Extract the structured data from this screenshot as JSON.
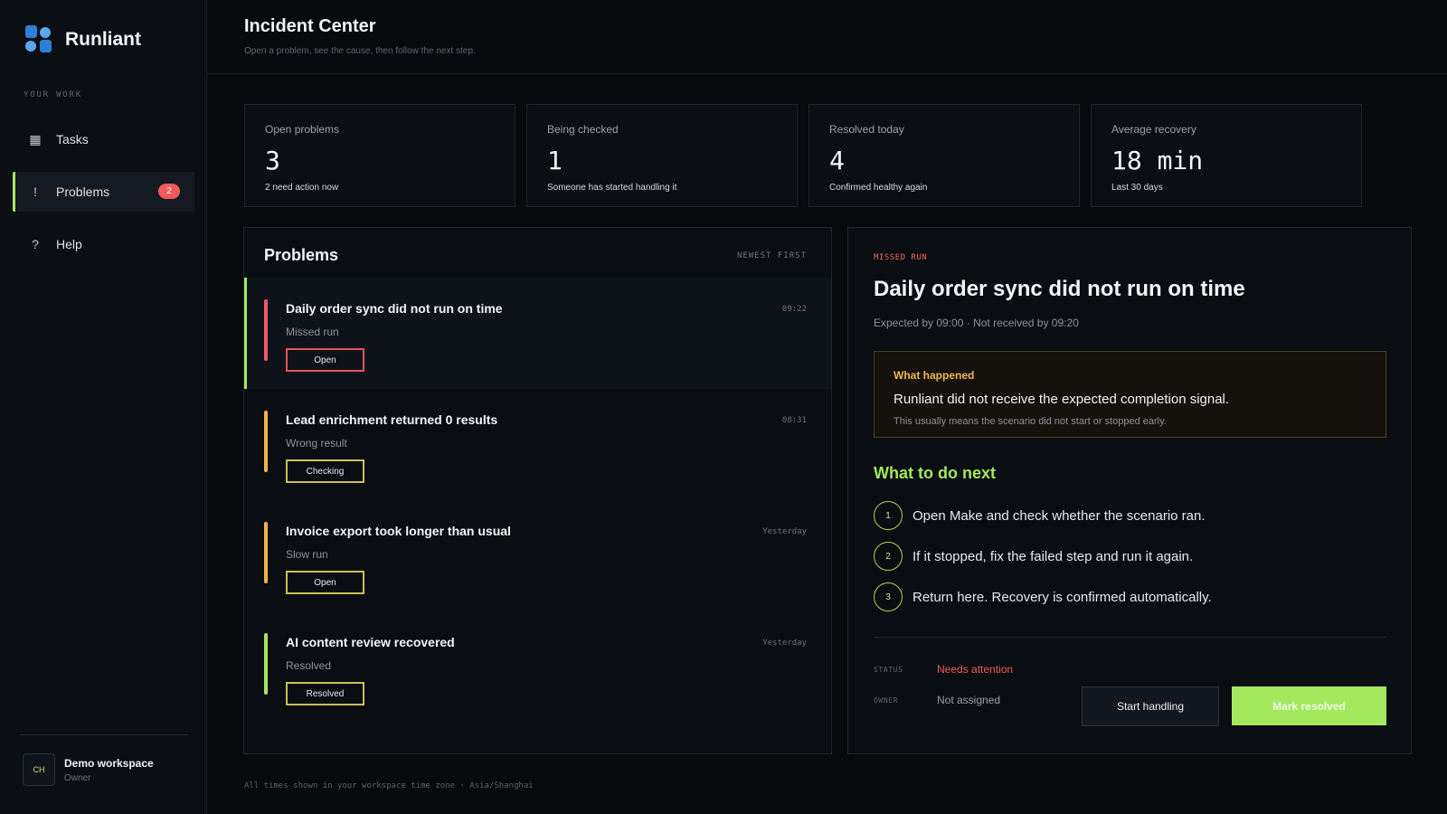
{
  "app": {
    "name": "Runliant"
  },
  "sidebar": {
    "section_label": "YOUR WORK",
    "items": [
      {
        "label": "Tasks",
        "icon": "grid-icon",
        "glyph": "▦"
      },
      {
        "label": "Problems",
        "icon": "exclamation-icon",
        "glyph": "!",
        "badge": "2",
        "active": true
      },
      {
        "label": "Help",
        "icon": "question-icon",
        "glyph": "?"
      }
    ],
    "workspace": {
      "initials": "CH",
      "name": "Demo workspace",
      "role": "Owner"
    }
  },
  "header": {
    "title": "Incident Center",
    "subtitle": "Open a problem, see the cause, then follow the next step."
  },
  "stats": [
    {
      "label": "Open problems",
      "value": "3",
      "note": "2 need action now"
    },
    {
      "label": "Being checked",
      "value": "1",
      "note": "Someone has started handling it"
    },
    {
      "label": "Resolved today",
      "value": "4",
      "note": "Confirmed healthy again"
    },
    {
      "label": "Average recovery",
      "value": "18 min",
      "note": "Last 30 days"
    }
  ],
  "problems": {
    "title": "Problems",
    "sort_label": "NEWEST FIRST",
    "items": [
      {
        "title": "Daily order sync did not run on time",
        "subtitle": "Missed run",
        "status": "Open",
        "time": "09:22",
        "bar_color": "#ef5a6a",
        "chip_border": "#e5545f"
      },
      {
        "title": "Lead enrichment returned 0 results",
        "subtitle": "Wrong result",
        "status": "Checking",
        "time": "08:31",
        "bar_color": "#f0b44c",
        "chip_border": "#c9c155"
      },
      {
        "title": "Invoice export took longer than usual",
        "subtitle": "Slow run",
        "status": "Open",
        "time": "Yesterday",
        "bar_color": "#f0b44c",
        "chip_border": "#c9c155"
      },
      {
        "title": "AI content review recovered",
        "subtitle": "Resolved",
        "status": "Resolved",
        "time": "Yesterday",
        "bar_color": "#a3e85d",
        "chip_border": "#c9c155"
      }
    ]
  },
  "detail": {
    "kicker": "MISSED RUN",
    "title": "Daily order sync did not run on time",
    "meta": "Expected by 09:00 · Not received by 09:20",
    "what_happened": {
      "label": "What happened",
      "main": "Runliant did not receive the expected completion signal.",
      "sub": "This usually means the scenario did not start or stopped early."
    },
    "next_title": "What to do next",
    "steps": [
      {
        "num": "1",
        "text": "Open Make and check whether the scenario ran."
      },
      {
        "num": "2",
        "text": "If it stopped, fix the failed step and run it again."
      },
      {
        "num": "3",
        "text": "Return here. Recovery is confirmed automatically."
      }
    ],
    "status_label": "STATUS",
    "status_value": "Needs attention",
    "owner_label": "OWNER",
    "owner_value": "Not assigned",
    "start_button": "Start handling",
    "resolve_button": "Mark resolved"
  },
  "footer": {
    "note": "All times shown in your workspace time zone · Asia/Shanghai"
  },
  "colors": {
    "accent": "#a3e85d",
    "danger": "#ef5a5a",
    "warning": "#f0b955",
    "brand": "#3b8fe6"
  }
}
